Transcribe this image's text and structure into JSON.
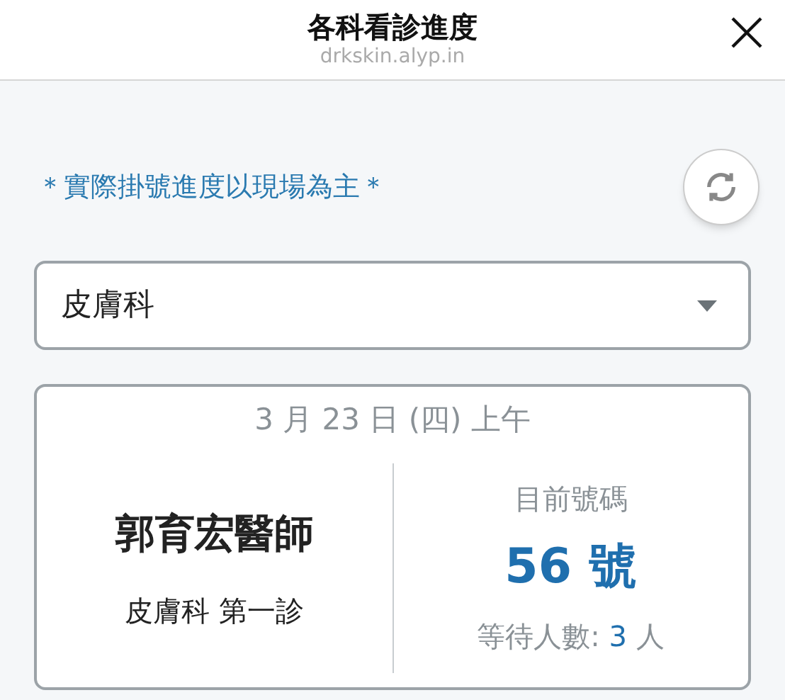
{
  "header": {
    "title": "各科看診進度",
    "url": "drkskin.alyp.in"
  },
  "notice": "＊實際掛號進度以現場為主＊",
  "department_select": {
    "value": "皮膚科"
  },
  "card": {
    "date": "3 月 23 日 (四) 上午",
    "doctor": "郭育宏醫師",
    "clinic": "皮膚科 第一診",
    "current_label": "目前號碼",
    "current_number": "56 號",
    "waiting": {
      "label": "等待人數:",
      "count": "3",
      "unit": "人"
    }
  }
}
